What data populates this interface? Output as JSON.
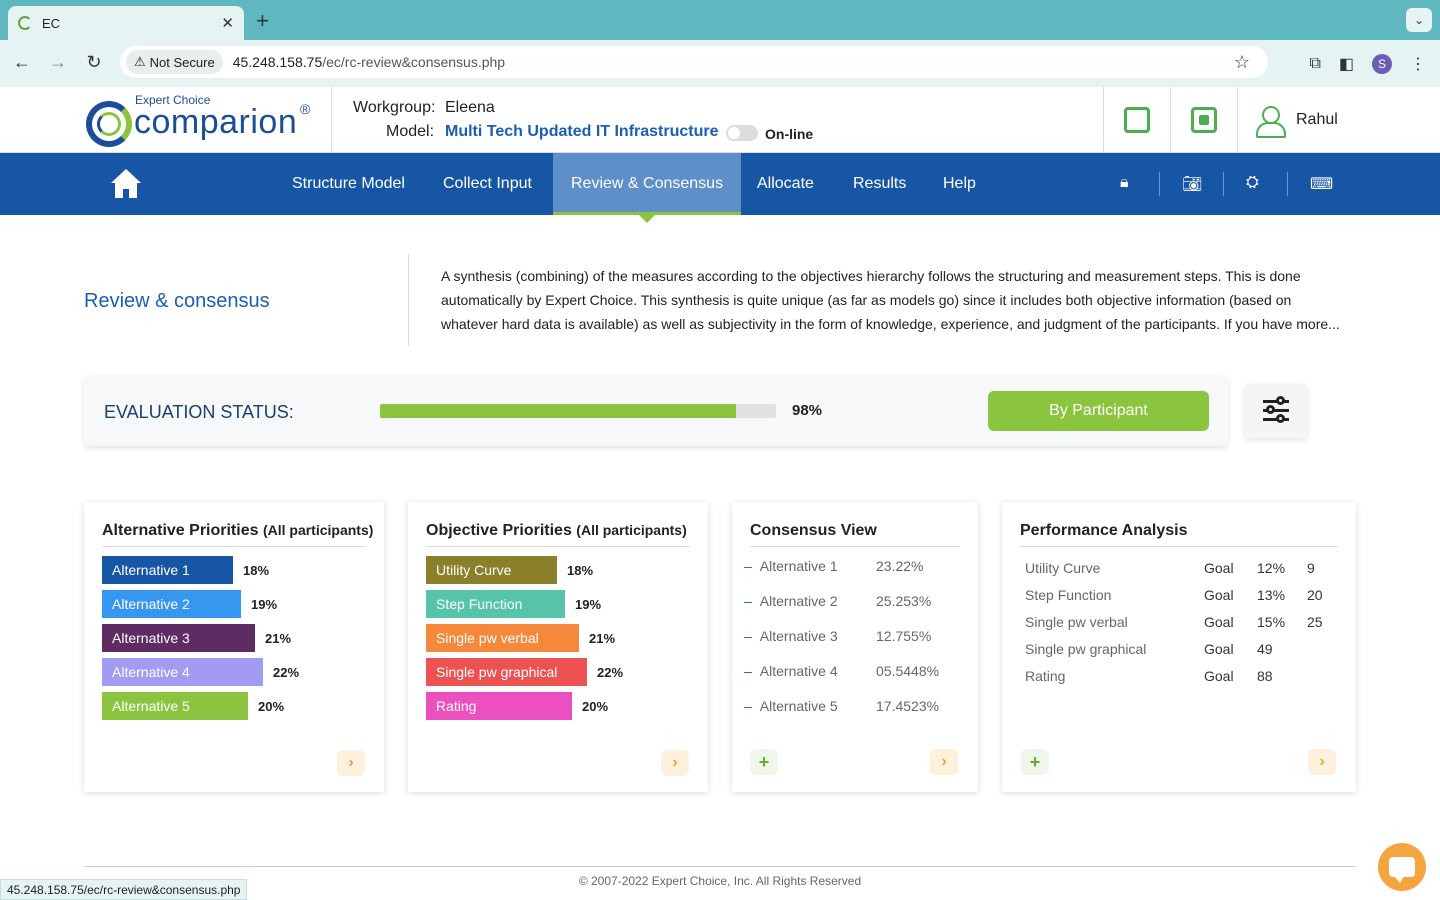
{
  "browser": {
    "tab_title": "EC",
    "tab_close": "✕",
    "new_tab": "+",
    "not_secure": "Not Secure",
    "url_host": "45.248.158.75",
    "url_path": "/ec/rc-review&consensus.php",
    "profile_initial": "S",
    "status_url": "45.248.158.75/ec/rc-review&consensus.php"
  },
  "header": {
    "logo_sub": "Expert Choice",
    "logo_main": "comparion",
    "logo_reg": "®",
    "workgroup_label": "Workgroup:",
    "workgroup_value": "Eleena",
    "model_label": "Model:",
    "model_value": "Multi Tech Updated IT Infrastructure",
    "online_label": "On-line",
    "user_name": "Rahul"
  },
  "nav": {
    "items": [
      {
        "label": "Structure Model"
      },
      {
        "label": "Collect Input"
      },
      {
        "label": "Review & Consensus"
      },
      {
        "label": "Allocate"
      },
      {
        "label": "Results"
      },
      {
        "label": "Help"
      }
    ],
    "active_index": 2
  },
  "intro": {
    "title": "Review & consensus",
    "text": "A synthesis (combining) of the measures according to the objectives hierarchy follows the structuring and measurement steps. This is done automatically by Expert Choice. This synthesis is quite unique (as far as models go) since it includes both objective information (based on whatever hard data is available) as well as subjectivity in the form of knowledge, experience, and judgment of the participants. If you have more..."
  },
  "evaluation": {
    "label": "EVALUATION STATUS:",
    "progress_percent": 90,
    "progress_text": "98%",
    "button_label": "By Participant"
  },
  "alternative_priorities": {
    "title": "Alternative Priorities",
    "subtitle": "(All participants)",
    "rows": [
      {
        "label": "Alternative 1",
        "value": "18%",
        "pct": 18,
        "color": "#1656a5"
      },
      {
        "label": "Alternative 2",
        "value": "19%",
        "pct": 19,
        "color": "#3796ef"
      },
      {
        "label": "Alternative 3",
        "value": "21%",
        "pct": 21,
        "color": "#5e2c63"
      },
      {
        "label": "Alternative 4",
        "value": "22%",
        "pct": 22,
        "color": "#a19bf1"
      },
      {
        "label": "Alternative 5",
        "value": "20%",
        "pct": 20,
        "color": "#8bc53f"
      }
    ]
  },
  "objective_priorities": {
    "title": "Objective Priorities",
    "subtitle": "(All participants)",
    "rows": [
      {
        "label": "Utility Curve",
        "value": "18%",
        "pct": 18,
        "color": "#8a7f2a"
      },
      {
        "label": "Step Function",
        "value": "19%",
        "pct": 19,
        "color": "#55c4a8"
      },
      {
        "label": "Single pw verbal",
        "value": "21%",
        "pct": 21,
        "color": "#f5883a"
      },
      {
        "label": "Single pw graphical",
        "value": "22%",
        "pct": 22,
        "color": "#ec5252"
      },
      {
        "label": "Rating",
        "value": "20%",
        "pct": 20,
        "color": "#ec4fc0"
      }
    ]
  },
  "consensus_view": {
    "title": "Consensus View",
    "rows": [
      {
        "label": "Alternative 1",
        "value": "23.22%"
      },
      {
        "label": "Alternative 2",
        "value": "25.253%"
      },
      {
        "label": "Alternative 3",
        "value": "12.755%"
      },
      {
        "label": "Alternative 4",
        "value": "05.5448%"
      },
      {
        "label": "Alternative 5",
        "value": "17.4523%"
      }
    ]
  },
  "performance_analysis": {
    "title": "Performance Analysis",
    "rows": [
      {
        "name": "Utility Curve",
        "type": "Goal",
        "a": "12%",
        "b": "9"
      },
      {
        "name": "Step Function",
        "type": "Goal",
        "a": "13%",
        "b": "20"
      },
      {
        "name": "Single pw verbal",
        "type": "Goal",
        "a": "15%",
        "b": "25"
      },
      {
        "name": "Single pw graphical",
        "type": "Goal",
        "a": "49",
        "b": ""
      },
      {
        "name": "Rating",
        "type": "Goal",
        "a": "88",
        "b": ""
      }
    ]
  },
  "footer": {
    "copyright": "© 2007-2022 Expert Choice, Inc. All Rights Reserved"
  },
  "icons": {
    "arrow": "›",
    "plus": "+"
  }
}
